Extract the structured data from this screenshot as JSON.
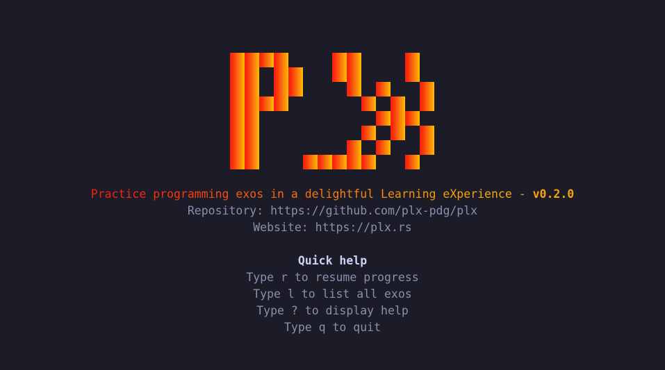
{
  "app": {
    "name": "plx",
    "background_color": "#1c1c28"
  },
  "logo": {
    "text": "PLX",
    "style": "pixel-block-art",
    "gradient_from": "#fa1e0e",
    "gradient_to": "#ffbe00",
    "cell": 21,
    "cols": 15,
    "rows": 8,
    "rowmap": [
      "111100011000100",
      "110110011000100",
      "110110001010010",
      "111100000101010",
      "110000000011100",
      "110000000101010",
      "110000001010010",
      "110001111100100"
    ]
  },
  "tagline": {
    "text": "Practice programming exos in a delightful Learning eXperience",
    "separator": " - ",
    "version": "v0.2.0",
    "version_color": "#f5a20f"
  },
  "links": {
    "repository_label": "Repository: ",
    "repository_url": "https://github.com/plx-pdg/plx",
    "website_label": "Website: ",
    "website_url": "https://plx.rs",
    "color": "#8a90ac"
  },
  "quick_help": {
    "title": "Quick help",
    "title_color": "#ccd2f2",
    "items": [
      {
        "text": "Type r to resume progress",
        "key": "r",
        "action": "resume progress"
      },
      {
        "text": "Type l to list all exos",
        "key": "l",
        "action": "list all exos"
      },
      {
        "text": "Type ? to display help",
        "key": "?",
        "action": "display help"
      },
      {
        "text": "Type q to quit",
        "key": "q",
        "action": "quit"
      }
    ]
  }
}
